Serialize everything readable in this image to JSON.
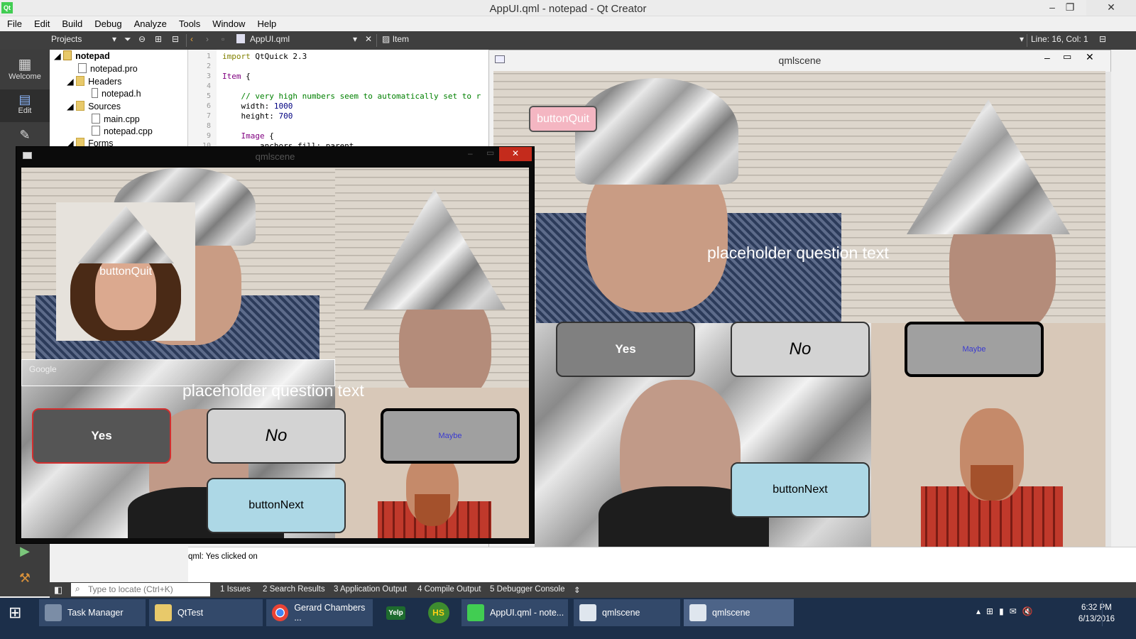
{
  "window": {
    "title": "AppUI.qml - notepad - Qt Creator",
    "app_icon": "Qt"
  },
  "menu": [
    "File",
    "Edit",
    "Build",
    "Debug",
    "Analyze",
    "Tools",
    "Window",
    "Help"
  ],
  "toolbar": {
    "projects_combo": "Projects",
    "file_combo": "AppUI.qml",
    "item_label": "Item",
    "position": "Line: 16, Col: 1"
  },
  "modes": {
    "welcome": "Welcome",
    "edit": "Edit"
  },
  "tree": {
    "project": "notepad",
    "pro": "notepad.pro",
    "headers": "Headers",
    "header_file": "notepad.h",
    "sources": "Sources",
    "source_1": "main.cpp",
    "source_2": "notepad.cpp",
    "forms": "Forms"
  },
  "editor": {
    "lines": [
      "1",
      "2",
      "3",
      "4",
      "5",
      "6",
      "7",
      "8",
      "9",
      "10"
    ],
    "l1_kw": "import",
    "l1_rest": " QtQuick 2.3",
    "l3_type": "Item",
    "l3_rest": " {",
    "l5": "    // very high numbers seem to automatically set to r",
    "l6_prop": "    width: ",
    "l6_val": "1000",
    "l7_prop": "    height: ",
    "l7_val": "700",
    "l9_type": "    Image",
    "l9_rest": " {",
    "l10": "        anchors.fill: parent"
  },
  "qml_window_right": {
    "title": "qmlscene",
    "button_quit": "buttonQuit",
    "question": "placeholder question text",
    "yes": "Yes",
    "no": "No",
    "maybe": "Maybe",
    "next": "buttonNext"
  },
  "qml_window_left": {
    "title": "qmlscene",
    "button_quit": "buttonQuit",
    "question": "placeholder question text",
    "yes": "Yes",
    "no": "No",
    "maybe": "Maybe",
    "next": "buttonNext",
    "overlay_logo": "Google"
  },
  "output": {
    "message": "qml: Yes clicked on"
  },
  "bottom": {
    "locate_placeholder": "Type to locate (Ctrl+K)",
    "tabs": [
      "1  Issues",
      "2  Search Results",
      "3  Application Output",
      "4  Compile Output",
      "5  Debugger Console"
    ]
  },
  "taskbar": {
    "items": [
      "Task Manager",
      "QtTest",
      "Gerard Chambers ...",
      "AppUI.qml - note...",
      "qmlscene",
      "qmlscene"
    ],
    "yelp": "Yelp",
    "hs": "HS",
    "time": "6:32 PM",
    "date": "6/13/2016"
  },
  "colors": {
    "ide_dark": "#3f3f3f",
    "quit_pink": "#f4b6c2",
    "next_blue": "#add8e6",
    "yes_dark_grey": "#555555",
    "no_light_grey": "#d3d3d3",
    "maybe_text": "#3a3ad0",
    "taskbar": "#1c2f4a"
  }
}
